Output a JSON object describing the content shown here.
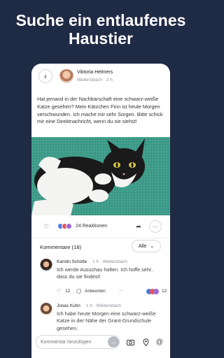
{
  "headline": "Suche ein entlaufenes Haustier",
  "post": {
    "author": "Viktoria Helmers",
    "location": "Weitersbach",
    "time": "2 h",
    "text": "Hat jemand in der Nachbarschaft eine schwarz-weiße Katze gesehen? Mein Kätzchen Finn ist heute Morgen verschwunden. Ich mache mir sehr Sorgen. Bitte schick mir eine Direktnachricht, wenn du sie siehst!",
    "reactions_label": "24 Reaktionen"
  },
  "comments_header": {
    "title": "Kommentare (18)",
    "sort_label": "Alle"
  },
  "comments": [
    {
      "author": "Karolin Schütte",
      "time": "1 h",
      "location": "Weitersbach",
      "text": "Ich werde Ausschau halten. Ich hoffe sehr, dass du sie findest!",
      "likes": "12",
      "reply_label": "Antworten",
      "reactions_count": "12"
    },
    {
      "author": "Jonas Kuhn",
      "time": "1 h",
      "location": "Weitersbach",
      "text": "Ich habe heute Morgen eine schwarz-weiße Katze in der Nähe der Grant-Grundschule gesehen."
    }
  ],
  "comment_bar": {
    "placeholder": "Kommentar hinzufügen"
  },
  "icons": {
    "back": "chevron-left-icon",
    "like": "heart-icon",
    "share": "share-arrow-icon",
    "more": "more-horizontal-icon",
    "sort": "chevron-down-icon",
    "reply": "speech-bubble-icon",
    "send": "arrow-right-icon",
    "camera": "camera-icon",
    "location": "location-pin-icon",
    "mention": "at-sign-icon"
  },
  "colors": {
    "background": "#1f2a44",
    "image_background": "#3f9c8a",
    "reaction_blue": "#4a7be0",
    "reaction_red": "#e45555",
    "reaction_purple": "#9b6ad6"
  }
}
